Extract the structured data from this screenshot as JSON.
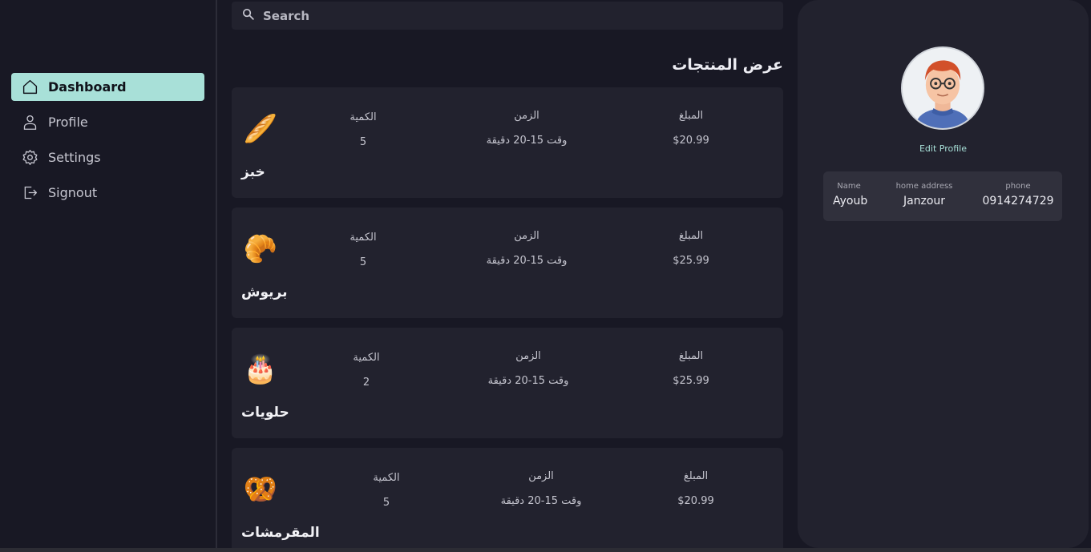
{
  "sidebar": {
    "items": [
      {
        "label": "Dashboard",
        "icon": "home-icon",
        "active": true
      },
      {
        "label": "Profile",
        "icon": "user-icon"
      },
      {
        "label": "Settings",
        "icon": "gear-icon"
      },
      {
        "label": "Signout",
        "icon": "logout-icon"
      }
    ]
  },
  "search": {
    "placeholder": "Search",
    "icon": "search-icon"
  },
  "main": {
    "title": "عرض المنتجات",
    "products": [
      {
        "name": "خبز",
        "emoji": "🥖",
        "qty_label": "الكمية",
        "qty": "5",
        "time_label": "الزمن",
        "time": "وقت 15-20 دقيقة",
        "price_label": "المبلغ",
        "price": "$20.99"
      },
      {
        "name": "بريوش",
        "emoji": "🥐",
        "qty_label": "الكمية",
        "qty": "5",
        "time_label": "الزمن",
        "time": "وقت 15-20 دقيقة",
        "price_label": "المبلغ",
        "price": "$25.99"
      },
      {
        "name": "حلويات",
        "emoji": "🎂",
        "qty_label": "الكمية",
        "qty": "2",
        "time_label": "الزمن",
        "time": "وقت 15-20 دقيقة",
        "price_label": "المبلغ",
        "price": "$25.99"
      },
      {
        "name": "المقرمشات",
        "emoji": "🥨",
        "qty_label": "الكمية",
        "qty": "5",
        "time_label": "الزمن",
        "time": "وقت 15-20 دقيقة",
        "price_label": "المبلغ",
        "price": "$20.99"
      }
    ]
  },
  "profile": {
    "edit_label": "Edit Profile",
    "fields": [
      {
        "key": "Name",
        "value": "Ayoub"
      },
      {
        "key": "home address",
        "value": "Janzour"
      },
      {
        "key": "phone",
        "value": "0914274729"
      }
    ]
  },
  "colors": {
    "accent": "#a8e0d8",
    "background": "#181824",
    "card": "#22222e"
  }
}
